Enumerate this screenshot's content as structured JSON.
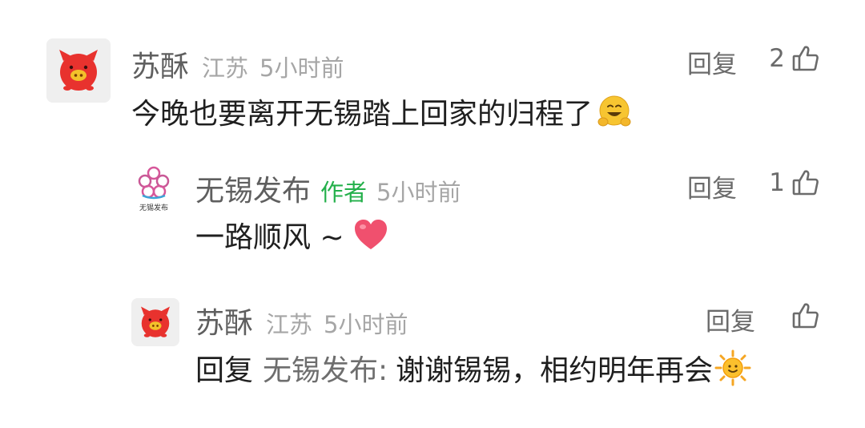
{
  "comments": [
    {
      "username": "苏酥",
      "location": "江苏",
      "time": "5小时前",
      "reply_label": "回复",
      "likes": "2",
      "text": "今晚也要离开无锡踏上回家的归程了",
      "emoji_icon": "hugging-face-icon",
      "avatar_icon": "red-pig-icon"
    },
    {
      "username": "无锡发布",
      "author_tag": "作者",
      "time": "5小时前",
      "reply_label": "回复",
      "likes": "1",
      "text": "一路顺风 ~",
      "emoji_icon": "red-heart-icon",
      "avatar_icon": "wuxi-fabu-logo",
      "avatar_text": "无锡发布"
    },
    {
      "username": "苏酥",
      "location": "江苏",
      "time": "5小时前",
      "reply_label": "回复",
      "likes": "",
      "reply_prefix": "回复",
      "reply_target": "无锡发布:",
      "text": "谢谢锡锡，相约明年再会",
      "emoji_icon": "sun-icon",
      "avatar_icon": "red-pig-icon"
    }
  ],
  "colors": {
    "author_tag": "#24b04b",
    "heart": "#f0506e",
    "pig": "#e8322e"
  }
}
